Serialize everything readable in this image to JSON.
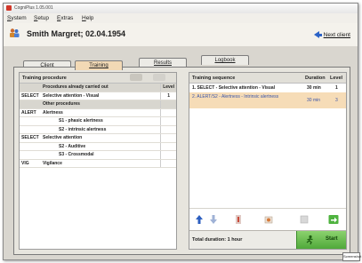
{
  "window": {
    "title": "CogniPlus 1.05.001"
  },
  "menu": [
    "System",
    "Setup",
    "Extras",
    "Help"
  ],
  "patient": {
    "name": "Smith Margret; 02.04.1954",
    "next_client_label": "Next client"
  },
  "tabs": [
    "Client",
    "Training",
    "Results",
    "Logbook"
  ],
  "active_tab": "Training",
  "left_panel": {
    "title": "Training procedure",
    "columns": [
      "Procedures already carried out",
      "Level"
    ],
    "rows": [
      {
        "code": "",
        "label": "Procedures already carried out",
        "level": "Level",
        "kind": "group"
      },
      {
        "code": "SELECT",
        "label": "Selective attention - Visual",
        "level": "1",
        "kind": "item"
      },
      {
        "code": "",
        "label": "Other procedures",
        "level": "",
        "kind": "group"
      },
      {
        "code": "ALERT",
        "label": "Alertness",
        "level": "",
        "kind": "item"
      },
      {
        "code": "",
        "label": "S1 - phasic alertness",
        "level": "",
        "kind": "sub"
      },
      {
        "code": "",
        "label": "S2 - intrinsic alertness",
        "level": "",
        "kind": "sub"
      },
      {
        "code": "SELECT",
        "label": "Selective attention",
        "level": "",
        "kind": "item"
      },
      {
        "code": "",
        "label": "S2 - Auditive",
        "level": "",
        "kind": "sub"
      },
      {
        "code": "",
        "label": "S3 - Crossmodal",
        "level": "",
        "kind": "sub"
      },
      {
        "code": "VIG",
        "label": "Vigilance",
        "level": "",
        "kind": "item"
      }
    ]
  },
  "right_panel": {
    "title": "Training sequence",
    "col_duration": "Duration",
    "col_level": "Level",
    "rows": [
      {
        "label": "1.  SELECT - Selective attention - Visual",
        "duration": "30 min",
        "level": "1"
      },
      {
        "label": "2.  ALERT/S2 - Alertness - Intrinsic alertness",
        "duration": "30 min",
        "level": "3"
      }
    ],
    "total_label": "Total duration: 1 hour",
    "start_label": "Start"
  },
  "colors": {
    "selection": "#f6dcb7",
    "start_green": "#4fa93a",
    "active_tab": "#f2d9b5"
  },
  "icons": [
    "patient-icon",
    "arrow-left-icon",
    "move-up-icon",
    "move-down-icon",
    "edit-icon",
    "copy-icon",
    "delete-icon",
    "export-icon",
    "start-icon"
  ],
  "badge": "Screenshot"
}
